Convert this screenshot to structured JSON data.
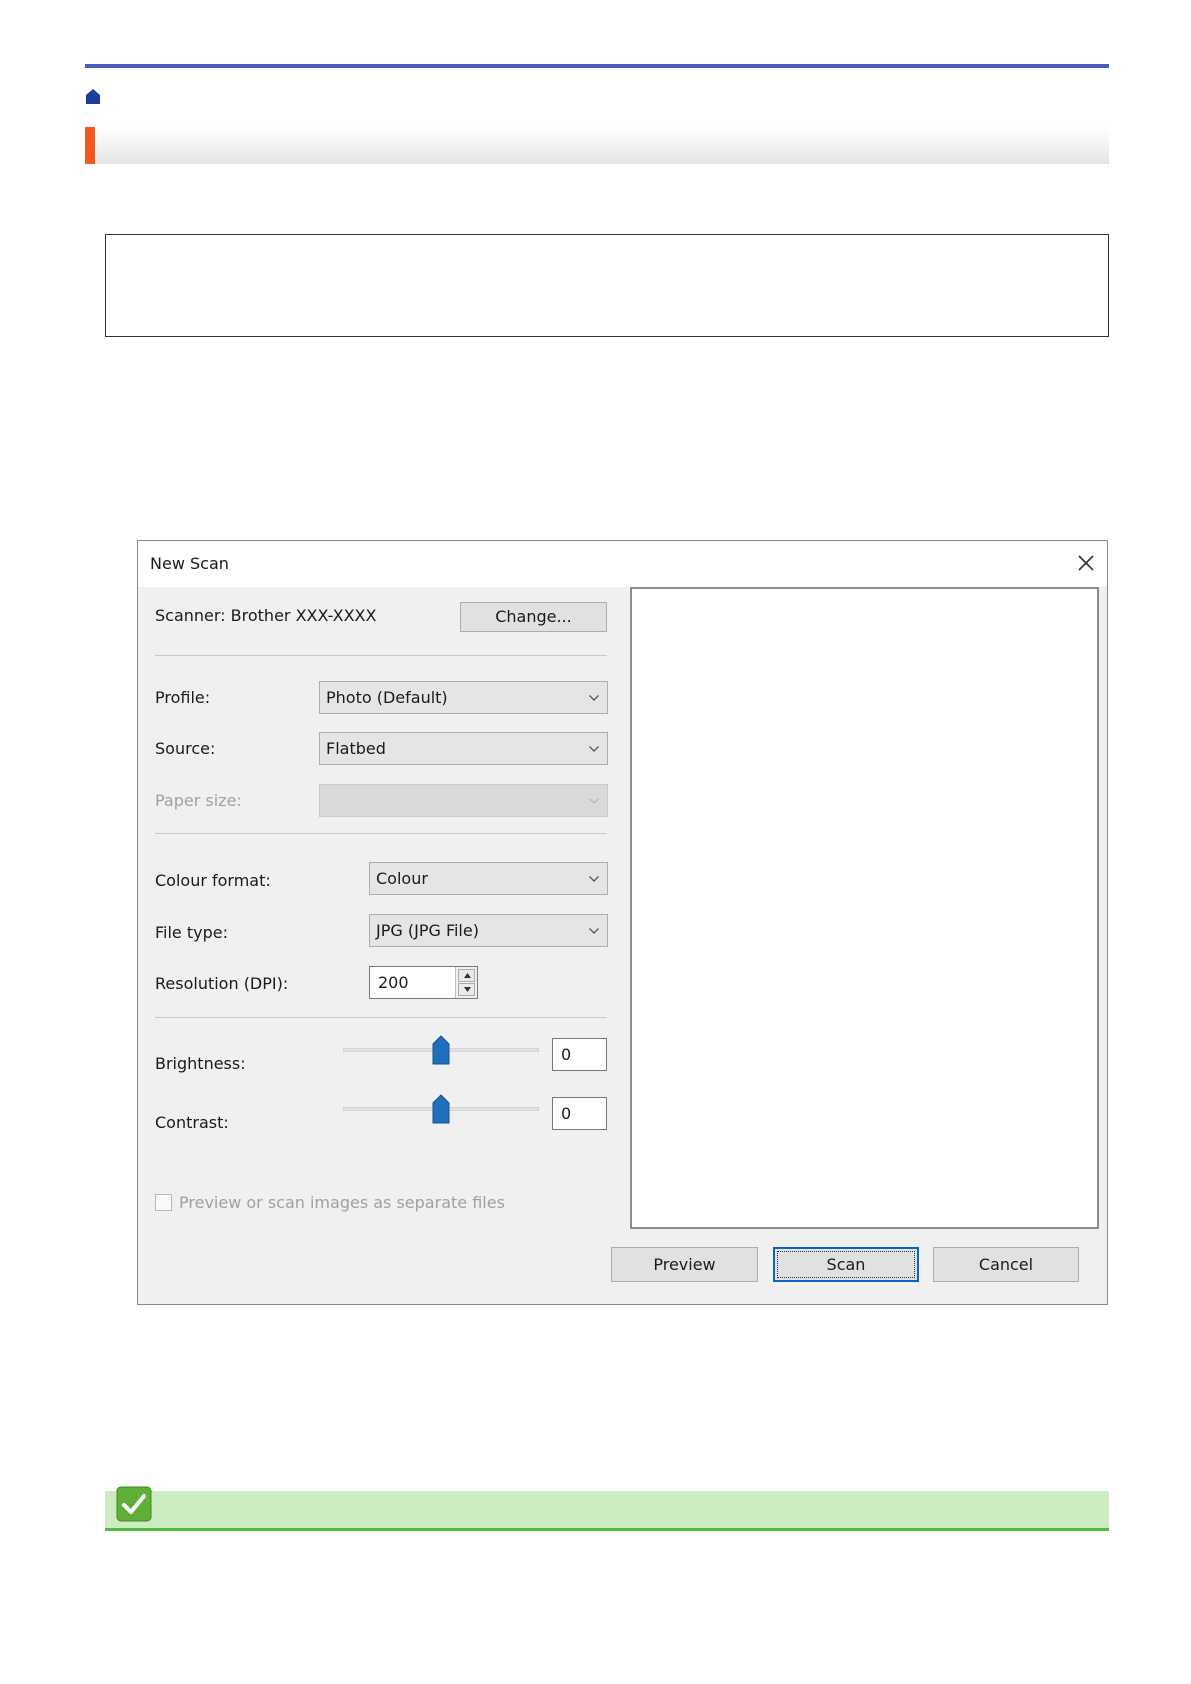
{
  "dialog": {
    "title": "New Scan",
    "scanner_label": "Scanner: Brother XXX-XXXX",
    "change_button": "Change...",
    "profile_label": "Profile:",
    "profile_value": "Photo (Default)",
    "source_label": "Source:",
    "source_value": "Flatbed",
    "paper_size_label": "Paper size:",
    "paper_size_value": "",
    "colour_format_label": "Colour format:",
    "colour_format_value": "Colour",
    "file_type_label": "File type:",
    "file_type_value": "JPG (JPG File)",
    "resolution_label": "Resolution (DPI):",
    "resolution_value": "200",
    "brightness_label": "Brightness:",
    "brightness_value": "0",
    "contrast_label": "Contrast:",
    "contrast_value": "0",
    "separate_files_label": "Preview or scan images as separate files",
    "preview_button": "Preview",
    "scan_button": "Scan",
    "cancel_button": "Cancel"
  },
  "colors": {
    "top_rule": "#4b5bbf",
    "accent": "#f0581c",
    "tip_bar": "#cdebc0",
    "tip_line": "#4cbf3a",
    "slider_thumb": "#1f6fbd"
  }
}
